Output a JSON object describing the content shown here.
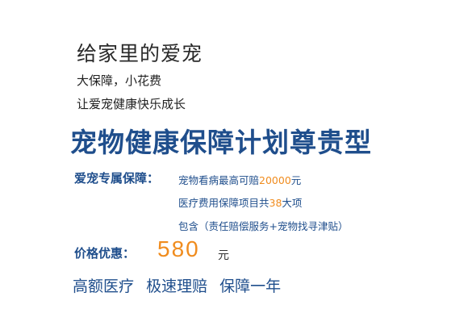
{
  "headline": "给家里的爱宠",
  "subtitle_1": "大保障，小花费",
  "subtitle_2": "让爱宠健康快乐成长",
  "plan_title": "宠物健康保障计划尊贵型",
  "benefits": {
    "label": "爱宠专属保障：",
    "item1_prefix": "宠物看病最高可赔",
    "item1_amount": "20000",
    "item1_suffix": "元",
    "item2_prefix": "医疗费用保障项目共",
    "item2_count": "38",
    "item2_suffix": "大项",
    "item3": "包含（责任赔偿服务+宠物找寻津贴）"
  },
  "price": {
    "label": "价格优惠：",
    "value": "580",
    "unit": "元"
  },
  "features": [
    "高额医疗",
    "极速理赔",
    "保障一年"
  ],
  "colors": {
    "primary_blue": "#1f4e8c",
    "accent_orange": "#f08c1e"
  }
}
